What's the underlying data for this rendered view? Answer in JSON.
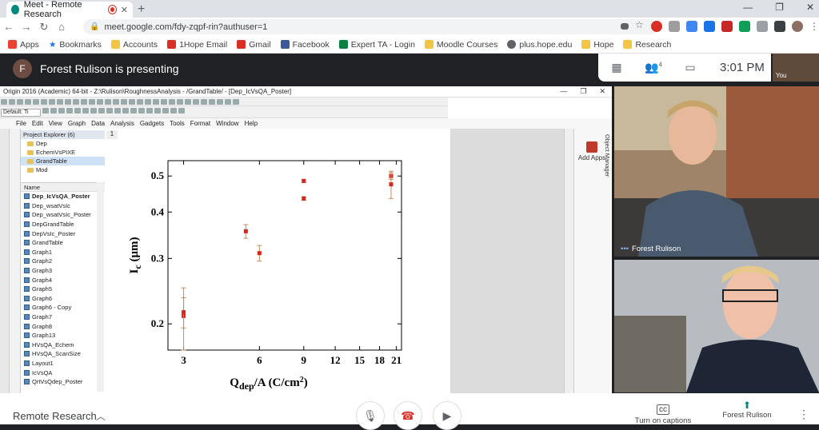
{
  "browser": {
    "tab_title": "Meet - Remote Research",
    "url": "meet.google.com/fdy-zqpf-rin?authuser=1",
    "bookmarks": [
      "Apps",
      "Bookmarks",
      "Accounts",
      "1Hope Email",
      "Gmail",
      "Facebook",
      "Expert TA - Login",
      "Moodle Courses",
      "plus.hope.edu",
      "Hope",
      "Research"
    ]
  },
  "meet": {
    "presenter_initial": "F",
    "presenting_text": "Forest Rulison is presenting",
    "participant_count": "4",
    "time": "3:01 PM",
    "self_label": "You",
    "meeting_name": "Remote Research",
    "captions_label": "Turn on captions",
    "presenting_label": "Forest Rulison",
    "tile1_name": "Forest Rulison"
  },
  "origin": {
    "title": "Origin 2016 (Academic) 64-bit - Z:\\Rulison\\RoughnessAnalysis - /GrandTable/ - [Dep_IcVsQA_Poster]",
    "menu": [
      "File",
      "Edit",
      "View",
      "Graph",
      "Data",
      "Analysis",
      "Gadgets",
      "Tools",
      "Format",
      "Window",
      "Help"
    ],
    "project_explorer": "Project Explorer (6)",
    "folders": [
      "Dep",
      "EchemVsPIXE",
      "GrandTable",
      "Mod"
    ],
    "selected_folder": "GrandTable",
    "list_header": "Name",
    "items": [
      "Dep_IcVsQA_Poster",
      "Dep_wsatVsIc",
      "Dep_wsatVsIc_Poster",
      "DepGrandTable",
      "DepVsIc_Poster",
      "GrandTable",
      "Graph1",
      "Graph2",
      "Graph3",
      "Graph4",
      "Graph5",
      "Graph6",
      "Graph6 - Copy",
      "Graph7",
      "Graph8",
      "Graph13",
      "HVsQA_Echem",
      "HVsQA_ScanSize",
      "Layout1",
      "IcVsQA",
      "QrtVsQdep_Poster"
    ],
    "tab_number": "1",
    "add_apps": "Add Apps",
    "object_manager": "Object Manager",
    "font_box": "Default: Ti"
  },
  "chart_data": {
    "type": "scatter",
    "xscale": "log",
    "yscale": "log",
    "xlim": [
      2.6,
      22
    ],
    "ylim": [
      0.17,
      0.55
    ],
    "xticks": [
      3,
      6,
      9,
      12,
      15,
      18,
      21
    ],
    "yticks": [
      0.2,
      0.3,
      0.4,
      0.5
    ],
    "xlabel_main": "Q",
    "xlabel_sub": "dep",
    "xlabel_rest": "/A (C/cm",
    "xlabel_sup": "2",
    "xlabel_end": ")",
    "ylabel_main": "I",
    "ylabel_sub": "c",
    "ylabel_rest": " (μm)",
    "points": [
      {
        "x": 3.0,
        "y": 0.21,
        "err": 0.04
      },
      {
        "x": 3.0,
        "y": 0.215,
        "err": 0.02
      },
      {
        "x": 5.3,
        "y": 0.355,
        "err": 0.015
      },
      {
        "x": 6.0,
        "y": 0.31,
        "err": 0.015
      },
      {
        "x": 9.0,
        "y": 0.485,
        "err": 0.005
      },
      {
        "x": 9.0,
        "y": 0.435,
        "err": 0.005
      },
      {
        "x": 20.0,
        "y": 0.5,
        "err": 0.01
      },
      {
        "x": 20.0,
        "y": 0.475,
        "err": 0.04
      }
    ],
    "marker_color": "#d9261c",
    "error_color": "#c98a5a"
  }
}
